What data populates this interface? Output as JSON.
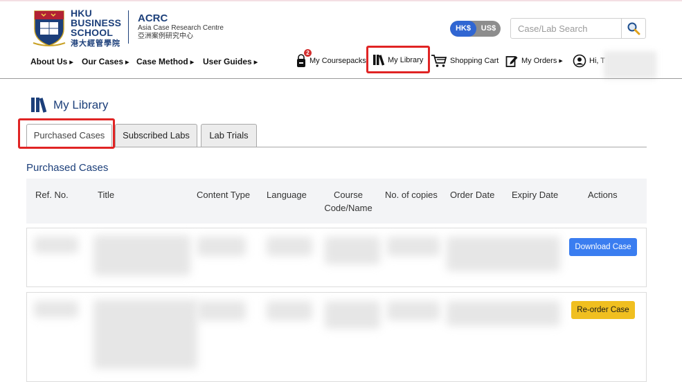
{
  "header": {
    "logo": {
      "line1": "HKU",
      "line2": "BUSINESS",
      "line3": "SCHOOL",
      "chinese": "港大經管學院"
    },
    "centre": {
      "abbr": "ACRC",
      "name": "Asia Case Research Centre",
      "chinese": "亞洲案例研究中心"
    },
    "currency": {
      "active": "HK$",
      "other": "US$"
    },
    "search": {
      "placeholder": "Case/Lab Search"
    },
    "nav": [
      {
        "label": "About Us"
      },
      {
        "label": "Our Cases"
      },
      {
        "label": "Case Method"
      },
      {
        "label": "User Guides"
      }
    ],
    "utility": {
      "coursepacks": "My Coursepacks",
      "coursepacks_badge": "2",
      "library": "My Library",
      "cart": "Shopping Cart",
      "orders": "My Orders",
      "greeting": "Hi, T"
    }
  },
  "page": {
    "title": "My Library",
    "tabs": [
      {
        "label": "Purchased Cases",
        "active": true
      },
      {
        "label": "Subscribed Labs",
        "active": false
      },
      {
        "label": "Lab Trials",
        "active": false
      }
    ],
    "section_title": "Purchased Cases",
    "table": {
      "headers": {
        "ref": "Ref. No.",
        "title": "Title",
        "content_type": "Content Type",
        "language": "Language",
        "course_line1": "Course",
        "course_line2": "Code/Name",
        "copies": "No. of copies",
        "order_date": "Order Date",
        "expiry_date": "Expiry Date",
        "actions": "Actions"
      },
      "rows": [
        {
          "action": "Download Case",
          "action_color": "#3a7df0"
        },
        {
          "action": "Re-order Case",
          "action_color": "#f0bf20"
        }
      ]
    }
  },
  "colors": {
    "brand_navy": "#1c3f7a",
    "highlight_red": "#e02424",
    "currency_active": "#3066d2"
  }
}
